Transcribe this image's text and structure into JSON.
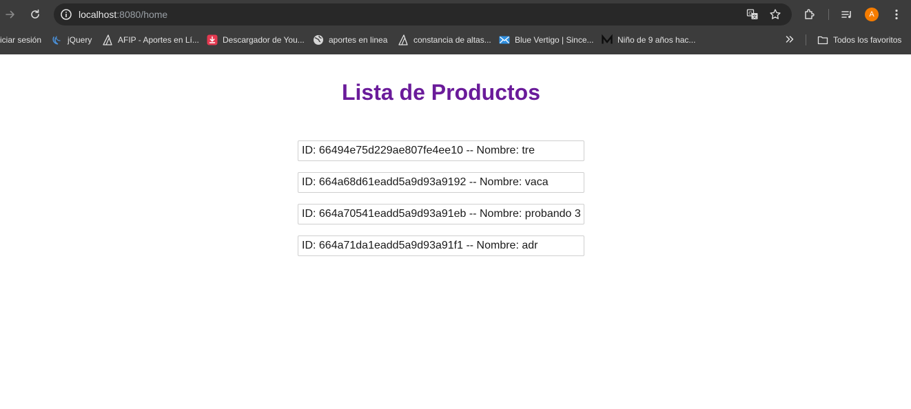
{
  "browser": {
    "url": {
      "host": "localhost",
      "rest": ":8080/home"
    },
    "avatar_initial": "A"
  },
  "bookmarks": {
    "items": [
      {
        "label": "iciar sesión",
        "icon": "partial-bookmark"
      },
      {
        "label": "jQuery",
        "icon": "jquery-icon"
      },
      {
        "label": "AFIP - Aportes en Lí...",
        "icon": "afip-icon"
      },
      {
        "label": "Descargador de You...",
        "icon": "download-icon"
      },
      {
        "label": "aportes en linea",
        "icon": "globe-icon"
      },
      {
        "label": "constancia de altas...",
        "icon": "afip-icon"
      },
      {
        "label": "Blue Vertigo | Since...",
        "icon": "mail-icon"
      },
      {
        "label": "Niño de 9 años hac...",
        "icon": "medium-icon"
      }
    ],
    "all_bookmarks_label": "Todos los favoritos"
  },
  "page": {
    "title": "Lista de Productos",
    "products": [
      {
        "text": "ID: 66494e75d229ae807fe4ee10 -- Nombre: tre"
      },
      {
        "text": "ID: 664a68d61eadd5a9d93a9192 -- Nombre: vaca"
      },
      {
        "text": "ID: 664a70541eadd5a9d93a91eb -- Nombre: probando 3"
      },
      {
        "text": "ID: 664a71da1eadd5a9d93a91f1 -- Nombre: adr"
      }
    ]
  },
  "colors": {
    "chrome_bg": "#3c3c3c",
    "omnibox_bg": "#282828",
    "title": "#6a1b9a",
    "avatar": "#f57c00"
  }
}
